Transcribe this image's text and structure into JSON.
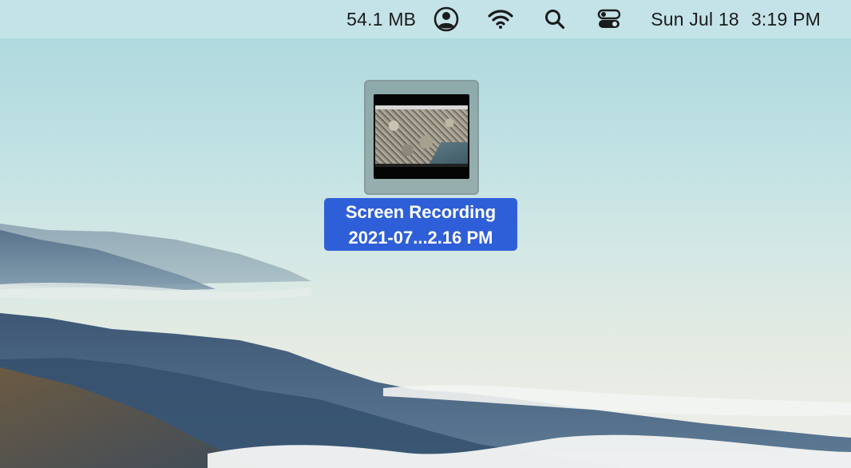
{
  "menubar": {
    "memory_usage": "54.1 MB",
    "icons": [
      "user-icon",
      "wifi-icon",
      "search-icon",
      "control-center-icon"
    ],
    "date": "Sun Jul 18",
    "time": "3:19 PM"
  },
  "desktop": {
    "file": {
      "name_line1": "Screen Recording",
      "name_line2": "2021-07...2.16 PM",
      "type": "screen-recording-file-icon",
      "selected": true
    }
  },
  "colors": {
    "selection_blue": "#2f5fd8",
    "menubar_bg": "#cde8ec",
    "sky": "#a9d6dd"
  }
}
